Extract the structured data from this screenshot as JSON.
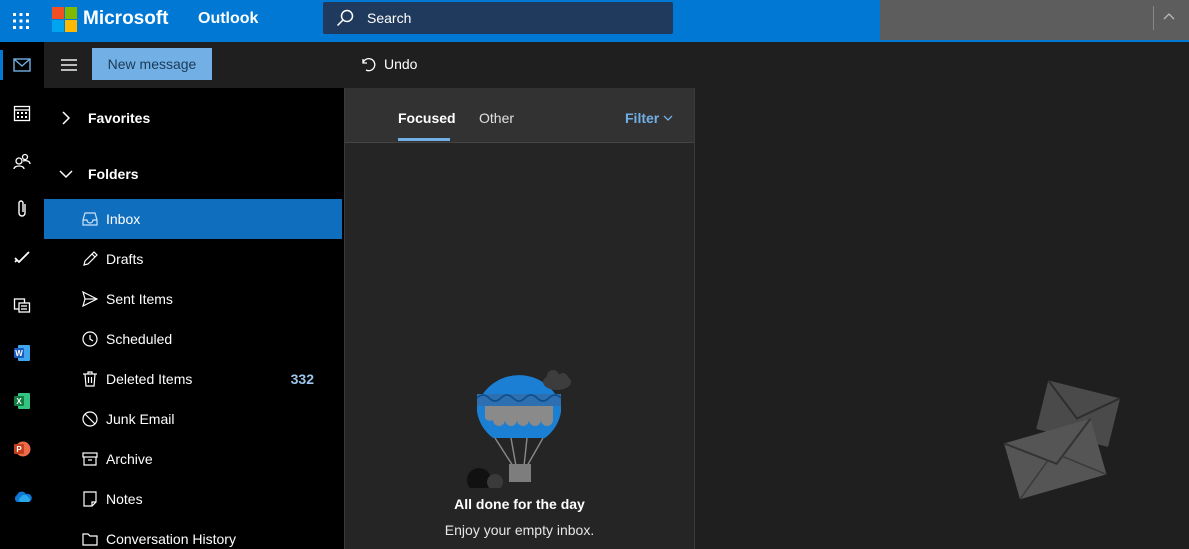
{
  "topbar": {
    "brand": "Microsoft",
    "app_name": "Outlook",
    "search_placeholder": "Search",
    "colors": {
      "bar": "#0078d4",
      "search": "#1f3a5c"
    }
  },
  "rail": {
    "items": [
      {
        "name": "mail",
        "icon": "mail-icon",
        "active": true
      },
      {
        "name": "calendar",
        "icon": "calendar-icon"
      },
      {
        "name": "people",
        "icon": "people-icon"
      },
      {
        "name": "files",
        "icon": "paperclip-icon"
      },
      {
        "name": "to-do",
        "icon": "checkmark-icon"
      },
      {
        "name": "groups",
        "icon": "groups-icon"
      },
      {
        "name": "word",
        "icon": "word-icon"
      },
      {
        "name": "excel",
        "icon": "excel-icon"
      },
      {
        "name": "powerpoint",
        "icon": "powerpoint-icon"
      },
      {
        "name": "onedrive",
        "icon": "onedrive-icon"
      }
    ]
  },
  "commandbar": {
    "new_message": "New message",
    "undo": "Undo"
  },
  "folders": {
    "favorites_label": "Favorites",
    "folders_label": "Folders",
    "items": [
      {
        "label": "Inbox",
        "icon": "inbox-icon",
        "selected": true,
        "count": ""
      },
      {
        "label": "Drafts",
        "icon": "pencil-icon",
        "count": ""
      },
      {
        "label": "Sent Items",
        "icon": "send-icon",
        "count": ""
      },
      {
        "label": "Scheduled",
        "icon": "clock-icon",
        "count": ""
      },
      {
        "label": "Deleted Items",
        "icon": "trash-icon",
        "count": "332"
      },
      {
        "label": "Junk Email",
        "icon": "block-icon",
        "count": ""
      },
      {
        "label": "Archive",
        "icon": "archive-icon",
        "count": ""
      },
      {
        "label": "Notes",
        "icon": "note-icon",
        "count": ""
      },
      {
        "label": "Conversation History",
        "icon": "folder-icon",
        "count": ""
      }
    ]
  },
  "messagelist": {
    "tabs": [
      "Focused",
      "Other"
    ],
    "active_tab": "Focused",
    "filter": "Filter",
    "empty_title": "All done for the day",
    "empty_subtitle": "Enjoy your empty inbox."
  }
}
